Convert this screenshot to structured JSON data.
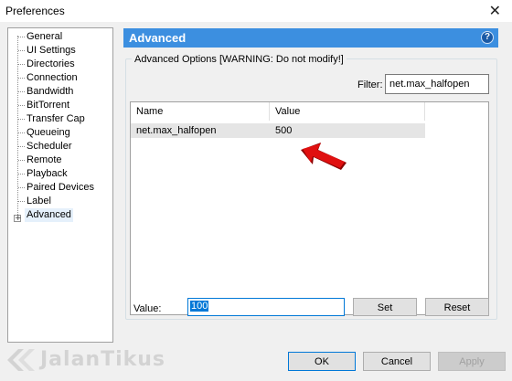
{
  "window": {
    "title": "Preferences",
    "close_icon": "close-icon"
  },
  "tree": {
    "items": [
      {
        "label": "General"
      },
      {
        "label": "UI Settings"
      },
      {
        "label": "Directories"
      },
      {
        "label": "Connection"
      },
      {
        "label": "Bandwidth"
      },
      {
        "label": "BitTorrent"
      },
      {
        "label": "Transfer Cap"
      },
      {
        "label": "Queueing"
      },
      {
        "label": "Scheduler"
      },
      {
        "label": "Remote"
      },
      {
        "label": "Playback"
      },
      {
        "label": "Paired Devices"
      },
      {
        "label": "Label"
      },
      {
        "label": "Advanced",
        "selected": true
      }
    ],
    "expander_glyph": "+"
  },
  "header": {
    "title": "Advanced",
    "help_glyph": "?",
    "color": "#3c8fe0"
  },
  "group": {
    "legend": "Advanced Options [WARNING: Do not modify!]"
  },
  "filter": {
    "label": "Filter:",
    "value": "net.max_halfopen"
  },
  "list": {
    "columns": [
      "Name",
      "Value"
    ],
    "rows": [
      {
        "name": "net.max_halfopen",
        "value": "500"
      }
    ]
  },
  "value_editor": {
    "label": "Value:",
    "value": "100"
  },
  "buttons": {
    "set": "Set",
    "reset": "Reset",
    "ok": "OK",
    "cancel": "Cancel",
    "apply": "Apply"
  },
  "watermark": {
    "text": "JalanTikus"
  },
  "annotation": {
    "arrow_color": "#e01010"
  }
}
